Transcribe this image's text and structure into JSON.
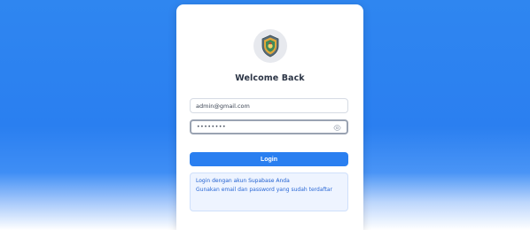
{
  "login": {
    "title": "Welcome Back",
    "email_value": "admin@gmail.com",
    "password_mask": "••••••••",
    "button_label": "Login",
    "info_title": "Login dengan akun Supabase Anda",
    "info_text": "Gunakan email dan password yang sudah terdaftar"
  },
  "icons": {
    "logo": "emblem-logo",
    "password_toggle": "eye-icon"
  },
  "colors": {
    "accent": "#2a7ff0",
    "info_bg": "#eef4ff",
    "info_text": "#2a68d6"
  }
}
